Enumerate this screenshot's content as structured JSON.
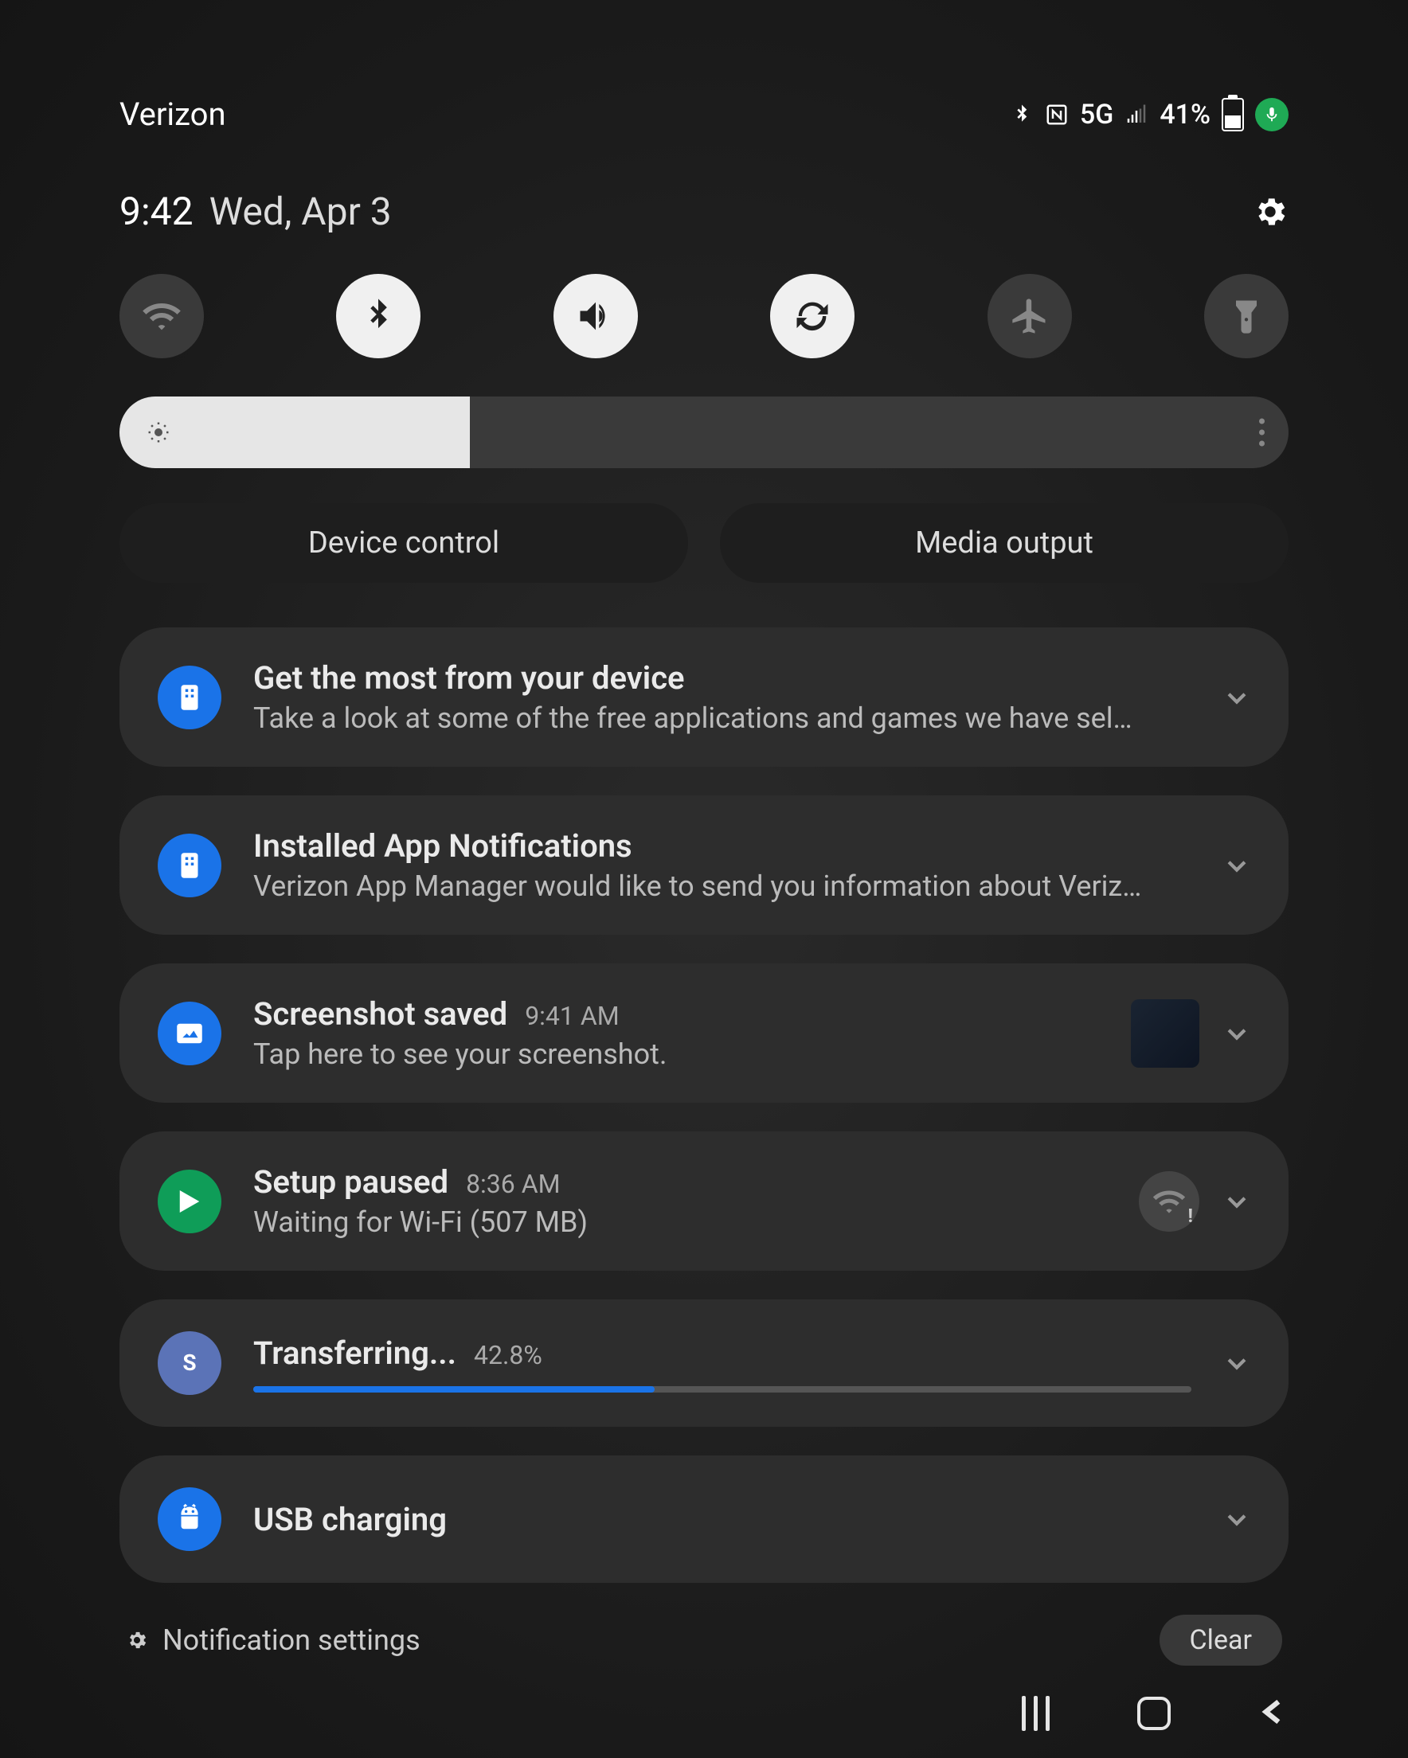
{
  "statusbar": {
    "carrier": "Verizon",
    "network": "5G",
    "battery_percent": "41%"
  },
  "header": {
    "time": "9:42",
    "date": "Wed, Apr 3"
  },
  "toggles": [
    {
      "name": "wifi",
      "active": false
    },
    {
      "name": "bluetooth",
      "active": true
    },
    {
      "name": "sound",
      "active": true
    },
    {
      "name": "autorotate",
      "active": true
    },
    {
      "name": "airplane",
      "active": false
    },
    {
      "name": "flashlight",
      "active": false
    }
  ],
  "brightness_percent": 30,
  "dual_buttons": {
    "device_control": "Device control",
    "media_output": "Media output"
  },
  "notifications": [
    {
      "icon_bg": "#1a73e8",
      "icon": "appgrid",
      "title": "Get the most from your device",
      "desc": "Take a look at some of the free applications and games we have sel…"
    },
    {
      "icon_bg": "#1a73e8",
      "icon": "appgrid",
      "title": "Installed App Notifications",
      "desc": "Verizon App Manager would like to send you information about Veriz…"
    },
    {
      "icon_bg": "#1a73e8",
      "icon": "image",
      "title": "Screenshot saved",
      "time": "9:41 AM",
      "desc": "Tap here to see your screenshot.",
      "has_thumb": true
    },
    {
      "icon_bg": "#0f9d58",
      "icon": "play",
      "title": "Setup paused",
      "time": "8:36 AM",
      "desc": "Waiting for Wi-Fi (507 MB)",
      "has_wifi_badge": true
    },
    {
      "icon_bg": "#5b73b7",
      "icon": "letter-s",
      "title": "Transferring...",
      "percent_label": "42.8%",
      "progress": 42.8
    },
    {
      "icon_bg": "#1a73e8",
      "icon": "android",
      "title": "USB charging"
    }
  ],
  "footer": {
    "settings_label": "Notification settings",
    "clear_label": "Clear"
  }
}
